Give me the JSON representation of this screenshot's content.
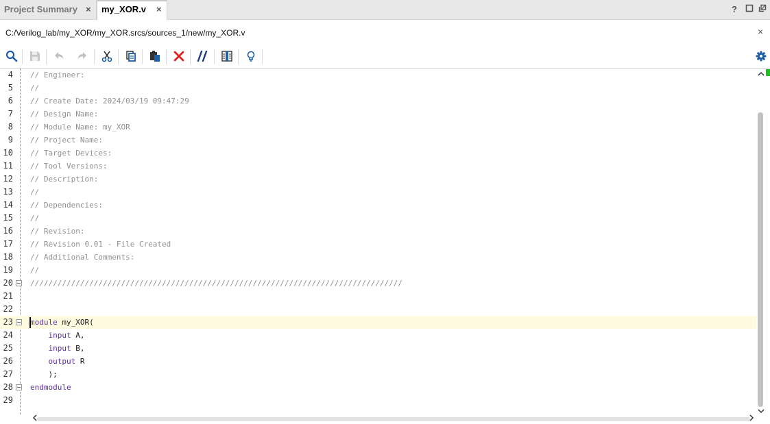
{
  "tabs": [
    {
      "label": "Project Summary",
      "close": "×",
      "active": false
    },
    {
      "label": "my_XOR.v",
      "close": "×",
      "active": true
    }
  ],
  "window_controls": {
    "help": "?",
    "maximize": "□",
    "restore": "⧉"
  },
  "path": {
    "text": "C:/Verilog_lab/my_XOR/my_XOR.srcs/sources_1/new/my_XOR.v",
    "close": "×"
  },
  "toolbar": {
    "items": [
      "search-icon",
      "save-icon",
      "undo-icon",
      "redo-icon",
      "cut-icon",
      "copy-icon",
      "paste-icon",
      "delete-icon",
      "comment-icon",
      "column-select-icon",
      "lightbulb-icon"
    ],
    "settings": "gear-icon"
  },
  "colors": {
    "comment": "#909090",
    "keyword": "#5a2d9e",
    "current_line": "#fffbe0",
    "accent_blue": "#1f5fa8",
    "delete_red": "#e02020"
  },
  "code_lines": [
    {
      "n": "4",
      "text": "// Engineer:"
    },
    {
      "n": "5",
      "text": "//"
    },
    {
      "n": "6",
      "text": "// Create Date: 2024/03/19 09:47:29"
    },
    {
      "n": "7",
      "text": "// Design Name:"
    },
    {
      "n": "8",
      "text": "// Module Name: my_XOR"
    },
    {
      "n": "9",
      "text": "// Project Name:"
    },
    {
      "n": "10",
      "text": "// Target Devices:"
    },
    {
      "n": "11",
      "text": "// Tool Versions:"
    },
    {
      "n": "12",
      "text": "// Description:"
    },
    {
      "n": "13",
      "text": "//"
    },
    {
      "n": "14",
      "text": "// Dependencies:"
    },
    {
      "n": "15",
      "text": "//"
    },
    {
      "n": "16",
      "text": "// Revision:"
    },
    {
      "n": "17",
      "text": "// Revision 0.01 - File Created"
    },
    {
      "n": "18",
      "text": "// Additional Comments:"
    },
    {
      "n": "19",
      "text": "//"
    },
    {
      "n": "20",
      "text": "//////////////////////////////////////////////////////////////////////////////////"
    },
    {
      "n": "21",
      "text": ""
    },
    {
      "n": "22",
      "text": ""
    },
    {
      "n": "23",
      "kw": "module",
      "rest": " my_XOR("
    },
    {
      "n": "24",
      "indent": "    ",
      "kw": "input",
      "rest": " A,"
    },
    {
      "n": "25",
      "indent": "    ",
      "kw": "input",
      "rest": " B,"
    },
    {
      "n": "26",
      "indent": "    ",
      "kw": "output",
      "rest": " R"
    },
    {
      "n": "27",
      "indent": "    ",
      "rest": ");"
    },
    {
      "n": "28",
      "kw": "endmodule",
      "rest": ""
    },
    {
      "n": "29",
      "text": ""
    }
  ],
  "scroll": {
    "up": "︿",
    "down": "﹀",
    "left": "<",
    "right": ">"
  }
}
